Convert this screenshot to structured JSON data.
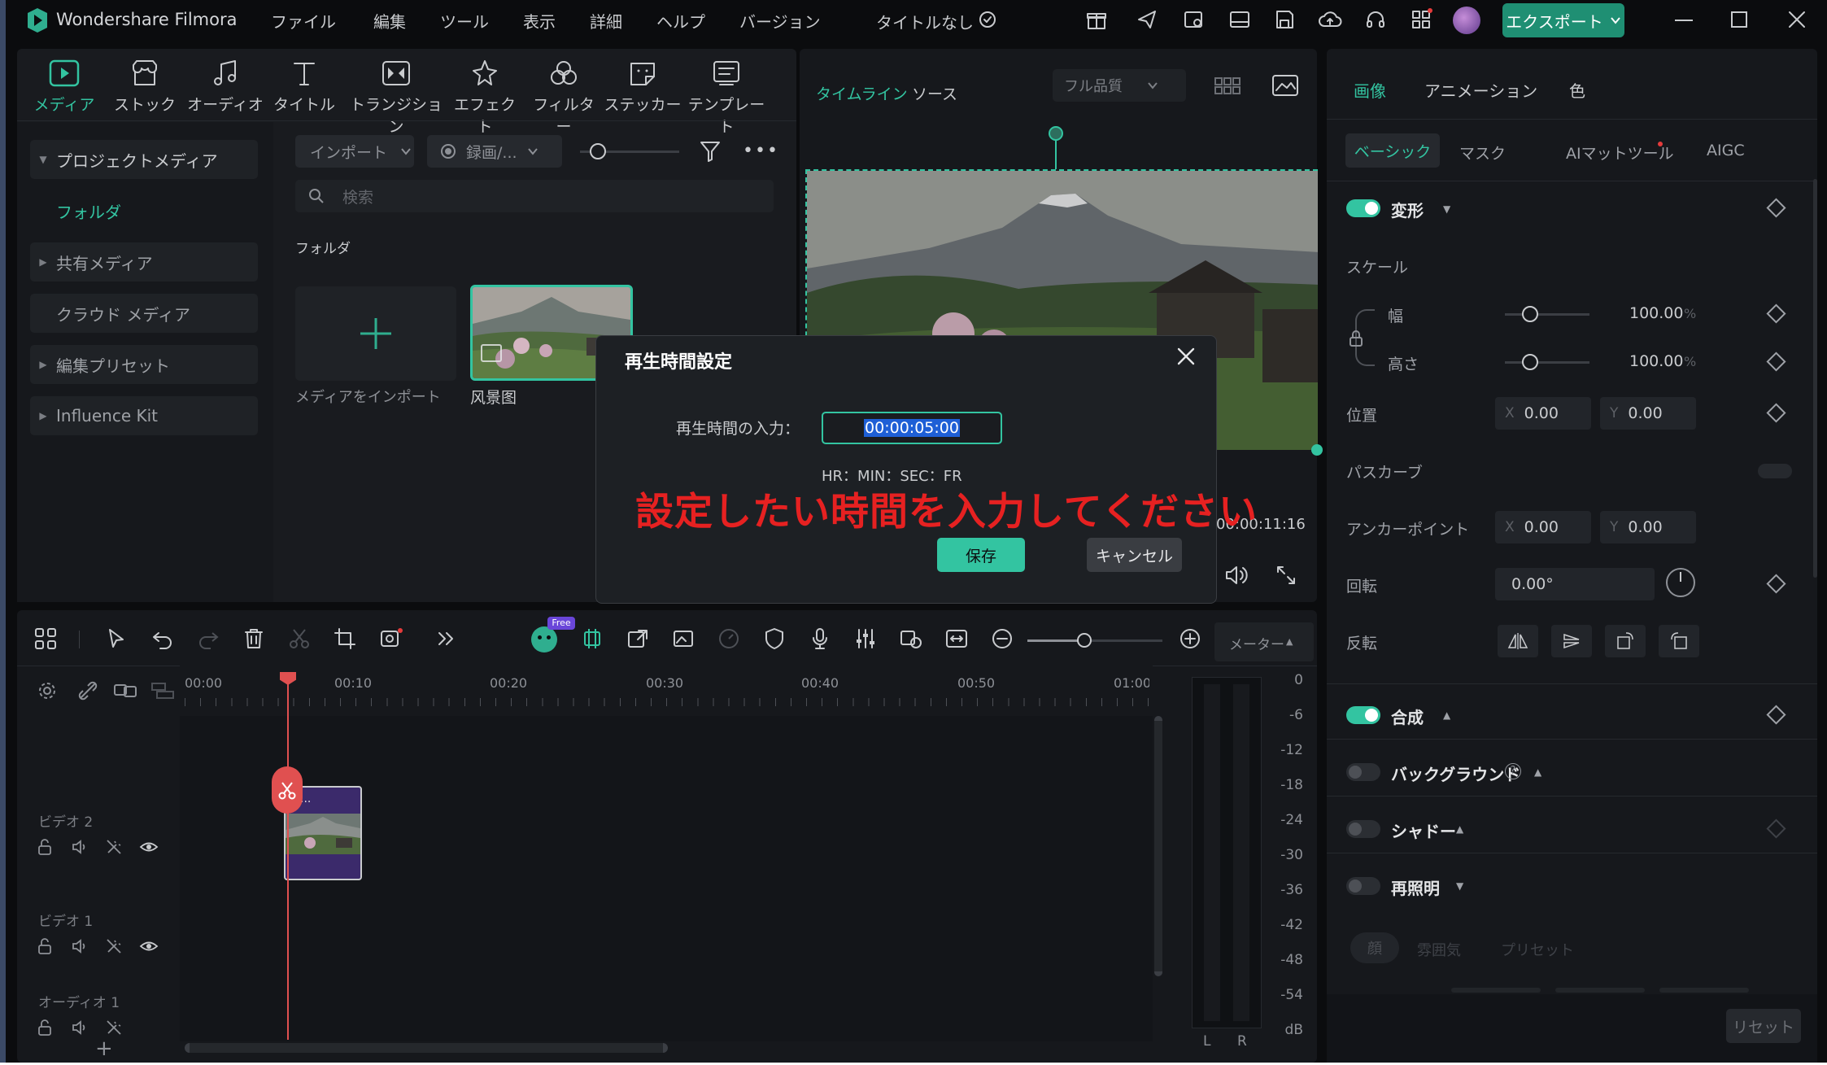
{
  "app": {
    "name": "Wondershare Filmora",
    "project_title": "タイトルなし",
    "export_label": "エクスポート",
    "menu": [
      "ファイル",
      "編集",
      "ツール",
      "表示",
      "詳細",
      "ヘルプ",
      "バージョン"
    ]
  },
  "media_tabs": [
    "メディア",
    "ストック",
    "オーディオ",
    "タイトル",
    "トランジション",
    "エフェクト",
    "フィルター",
    "ステッカー",
    "テンプレート"
  ],
  "sidebar": {
    "items": [
      {
        "label": "プロジェクトメディア"
      },
      {
        "label": "フォルダ"
      },
      {
        "label": "共有メディア"
      },
      {
        "label": "クラウド メディア"
      },
      {
        "label": "編集プリセット"
      },
      {
        "label": "Influence Kit"
      }
    ]
  },
  "media": {
    "import_label": "インポート",
    "record_label": "録画/...",
    "search_placeholder": "検索",
    "folder_label": "フォルダ",
    "import_tile_label": "メディアをインポート",
    "clip_label": "风景图"
  },
  "preview": {
    "tab_timeline": "タイムライン",
    "tab_source": "ソース",
    "quality": "フル品質",
    "timecode": "00:00:11:16"
  },
  "right_panel": {
    "tabs": [
      "画像",
      "アニメーション",
      "色"
    ],
    "subtabs": [
      "ベーシック",
      "マスク",
      "AIマットツール",
      "AIGC"
    ],
    "transform_label": "変形",
    "scale_label": "スケール",
    "width_label": "幅",
    "height_label": "高さ",
    "scale_value": "100.00",
    "percent": "%",
    "position_label": "位置",
    "pos_x": "0.00",
    "pos_y": "0.00",
    "x_axis": "X",
    "y_axis": "Y",
    "path_curve_label": "パスカーブ",
    "anchor_label": "アンカーポイント",
    "anchor_x": "0.00",
    "anchor_y": "0.00",
    "rotation_label": "回転",
    "rotation_value": "0.00°",
    "flip_label": "反転",
    "composite_label": "合成",
    "background_label": "バックグラウンド",
    "shadow_label": "シャドー",
    "relight_label": "再照明",
    "relight_tabs": [
      "顔",
      "雰囲気",
      "プリセット"
    ],
    "reset_label": "リセット"
  },
  "timeline": {
    "meter_label": "メーター",
    "free_badge": "Free",
    "ruler": [
      "00:00",
      "00:10",
      "00:20",
      "00:30",
      "00:40",
      "00:50",
      "01:00"
    ],
    "tracks": [
      "ビデオ 2",
      "ビデオ 1",
      "オーディオ 1"
    ],
    "clip_label": "...",
    "meter_scale": [
      "0",
      "-6",
      "-12",
      "-18",
      "-24",
      "-30",
      "-36",
      "-42",
      "-48",
      "-54",
      "dB"
    ],
    "meter_channels": [
      "L",
      "R"
    ]
  },
  "dialog": {
    "title": "再生時間設定",
    "input_label": "再生時間の入力：",
    "input_value": "00:00:05:00",
    "format_hint": "HR：MIN：SEC：FR",
    "annotation": "設定したい時間を入力してください",
    "save_label": "保存",
    "cancel_label": "キャンセル"
  },
  "colors": {
    "accent": "#33c4a1",
    "annotation_red": "#e62121",
    "background": "#0b0c0e",
    "panel": "#191b1f",
    "export_button": "#1f8f73"
  }
}
